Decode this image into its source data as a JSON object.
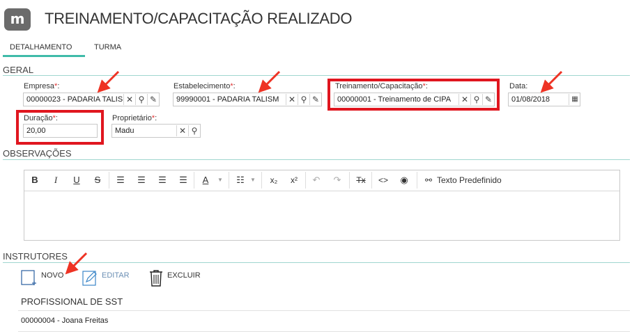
{
  "header": {
    "logo_letter": "m",
    "title": "TREINAMENTO/CAPACITAÇÃO REALIZADO"
  },
  "tabs": [
    {
      "label": "DETALHAMENTO",
      "active": true
    },
    {
      "label": "TURMA",
      "active": false
    }
  ],
  "geral": {
    "title": "GERAL",
    "empresa": {
      "label": "Empresa",
      "value": "00000023 - PADARIA TALIS"
    },
    "estabelecimento": {
      "label": "Estabelecimento",
      "value": "99990001 - PADARIA TALISM"
    },
    "treinamento": {
      "label": "Treinamento/Capacitação",
      "value": "00000001 - Treinamento de CIPA"
    },
    "data": {
      "label": "Data",
      "value": "01/08/2018"
    },
    "duracao": {
      "label": "Duração",
      "value": "20,00"
    },
    "proprietario": {
      "label": "Proprietário",
      "value": "Madu"
    },
    "required_mark": "*",
    "label_suffix": ":"
  },
  "observacoes": {
    "title": "OBSERVAÇÕES",
    "toolbar": {
      "bold": "B",
      "italic": "I",
      "underline": "U",
      "strike": "S",
      "font_color": "A",
      "subscript": "x₂",
      "superscript": "x²",
      "clear_format": "Tx",
      "code": "<>",
      "texto_predefinido": "Texto Predefinido"
    }
  },
  "instrutores": {
    "title": "INSTRUTORES",
    "actions": {
      "novo": "NOVO",
      "editar": "EDITAR",
      "excluir": "EXCLUIR"
    },
    "column_header": "PROFISSIONAL DE SST",
    "rows": [
      "00000004 - Joana Freitas"
    ]
  },
  "colors": {
    "accent": "#3fbba9",
    "highlight": "#e0161f",
    "required": "#e03030"
  }
}
